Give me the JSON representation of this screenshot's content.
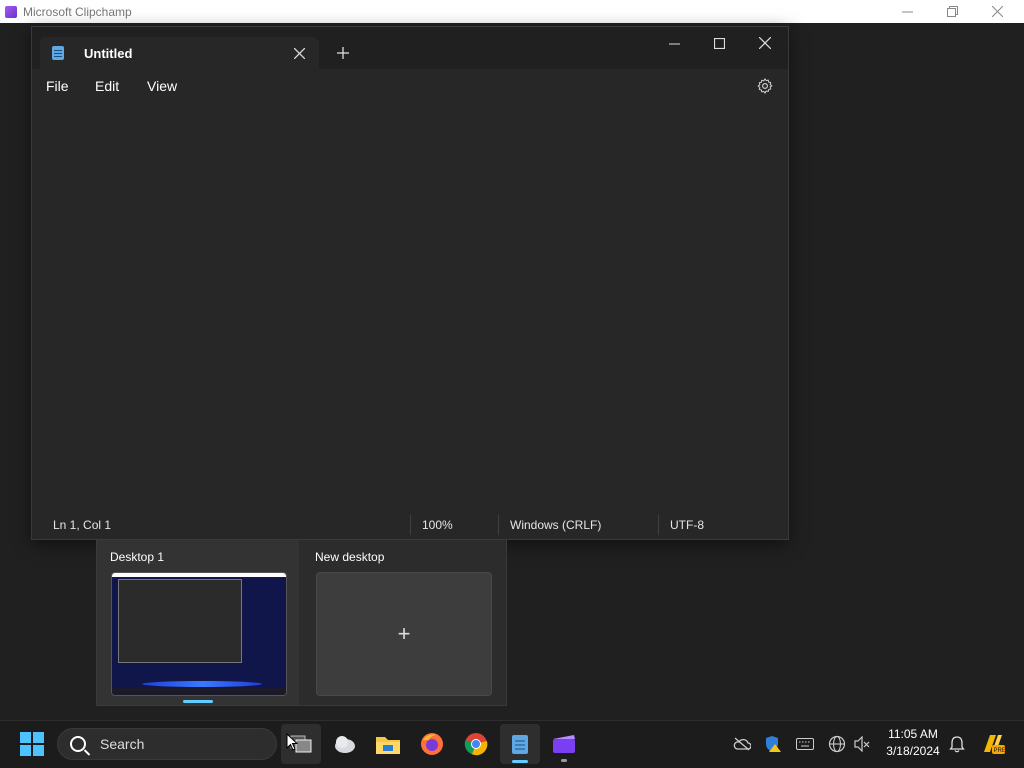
{
  "background_window": {
    "title": "Microsoft Clipchamp"
  },
  "notepad": {
    "tab_title": "Untitled",
    "menu": [
      "File",
      "Edit",
      "View"
    ],
    "status": {
      "position": "Ln 1, Col 1",
      "zoom": "100%",
      "line_ending": "Windows (CRLF)",
      "encoding": "UTF-8"
    }
  },
  "task_view": {
    "desktops": [
      {
        "label": "Desktop 1",
        "active": true
      },
      {
        "label": "New desktop",
        "active": false
      }
    ],
    "new_desktop_symbol": "+"
  },
  "taskbar": {
    "search_placeholder": "Search",
    "apps": [
      "task-view-icon",
      "weather-icon",
      "file-explorer-icon",
      "firefox-icon",
      "chrome-icon",
      "notepad-icon",
      "clipchamp-icon"
    ],
    "time": "11:05 AM",
    "date": "3/18/2024",
    "accent_color": "#60cdff"
  }
}
